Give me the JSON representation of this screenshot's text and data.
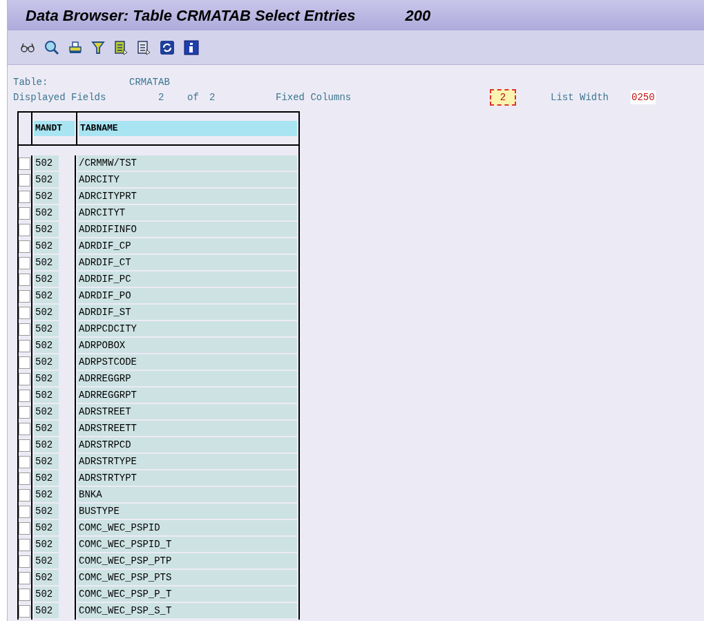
{
  "window": {
    "title": "Data Browser: Table CRMATAB Select Entries",
    "client": "200"
  },
  "toolbar": {
    "buttons": [
      {
        "kind": "glasses"
      },
      {
        "kind": "magnifier"
      },
      {
        "kind": "printer"
      },
      {
        "kind": "filter"
      },
      {
        "kind": "docgreen"
      },
      {
        "kind": "docgrey"
      },
      {
        "kind": "refresh"
      },
      {
        "kind": "info"
      }
    ]
  },
  "header": {
    "table_label": "Table:",
    "table_value": "CRMATAB",
    "fields_label": "Displayed Fields",
    "fields_shown": "2",
    "fields_of": "of",
    "fields_total": "2",
    "fixed_label": "Fixed Columns",
    "fixed_value": "2",
    "width_label": "List Width",
    "width_value": "0250"
  },
  "table": {
    "columns": [
      "MANDT",
      "TABNAME"
    ],
    "rows": [
      {
        "mandt": "502",
        "tabname": "/CRMMW/TST",
        "checked": false
      },
      {
        "mandt": "502",
        "tabname": "ADRCITY",
        "checked": false
      },
      {
        "mandt": "502",
        "tabname": "ADRCITYPRT",
        "checked": false
      },
      {
        "mandt": "502",
        "tabname": "ADRCITYT",
        "checked": false
      },
      {
        "mandt": "502",
        "tabname": "ADRDIFINFO",
        "checked": false
      },
      {
        "mandt": "502",
        "tabname": "ADRDIF_CP",
        "checked": false
      },
      {
        "mandt": "502",
        "tabname": "ADRDIF_CT",
        "checked": false
      },
      {
        "mandt": "502",
        "tabname": "ADRDIF_PC",
        "checked": false
      },
      {
        "mandt": "502",
        "tabname": "ADRDIF_PO",
        "checked": false
      },
      {
        "mandt": "502",
        "tabname": "ADRDIF_ST",
        "checked": false
      },
      {
        "mandt": "502",
        "tabname": "ADRPCDCITY",
        "checked": false
      },
      {
        "mandt": "502",
        "tabname": "ADRPOBOX",
        "checked": false
      },
      {
        "mandt": "502",
        "tabname": "ADRPSTCODE",
        "checked": false
      },
      {
        "mandt": "502",
        "tabname": "ADRREGGRP",
        "checked": false
      },
      {
        "mandt": "502",
        "tabname": "ADRREGGRPT",
        "checked": false
      },
      {
        "mandt": "502",
        "tabname": "ADRSTREET",
        "checked": false
      },
      {
        "mandt": "502",
        "tabname": "ADRSTREETT",
        "checked": false
      },
      {
        "mandt": "502",
        "tabname": "ADRSTRPCD",
        "checked": false
      },
      {
        "mandt": "502",
        "tabname": "ADRSTRTYPE",
        "checked": false
      },
      {
        "mandt": "502",
        "tabname": "ADRSTRTYPT",
        "checked": false
      },
      {
        "mandt": "502",
        "tabname": "BNKA",
        "checked": false
      },
      {
        "mandt": "502",
        "tabname": "BUSTYPE",
        "checked": false
      },
      {
        "mandt": "502",
        "tabname": "COMC_WEC_PSPID",
        "checked": false
      },
      {
        "mandt": "502",
        "tabname": "COMC_WEC_PSPID_T",
        "checked": false
      },
      {
        "mandt": "502",
        "tabname": "COMC_WEC_PSP_PTP",
        "checked": false
      },
      {
        "mandt": "502",
        "tabname": "COMC_WEC_PSP_PTS",
        "checked": false
      },
      {
        "mandt": "502",
        "tabname": "COMC_WEC_PSP_P_T",
        "checked": false
      },
      {
        "mandt": "502",
        "tabname": "COMC_WEC_PSP_S_T",
        "checked": false
      }
    ]
  }
}
